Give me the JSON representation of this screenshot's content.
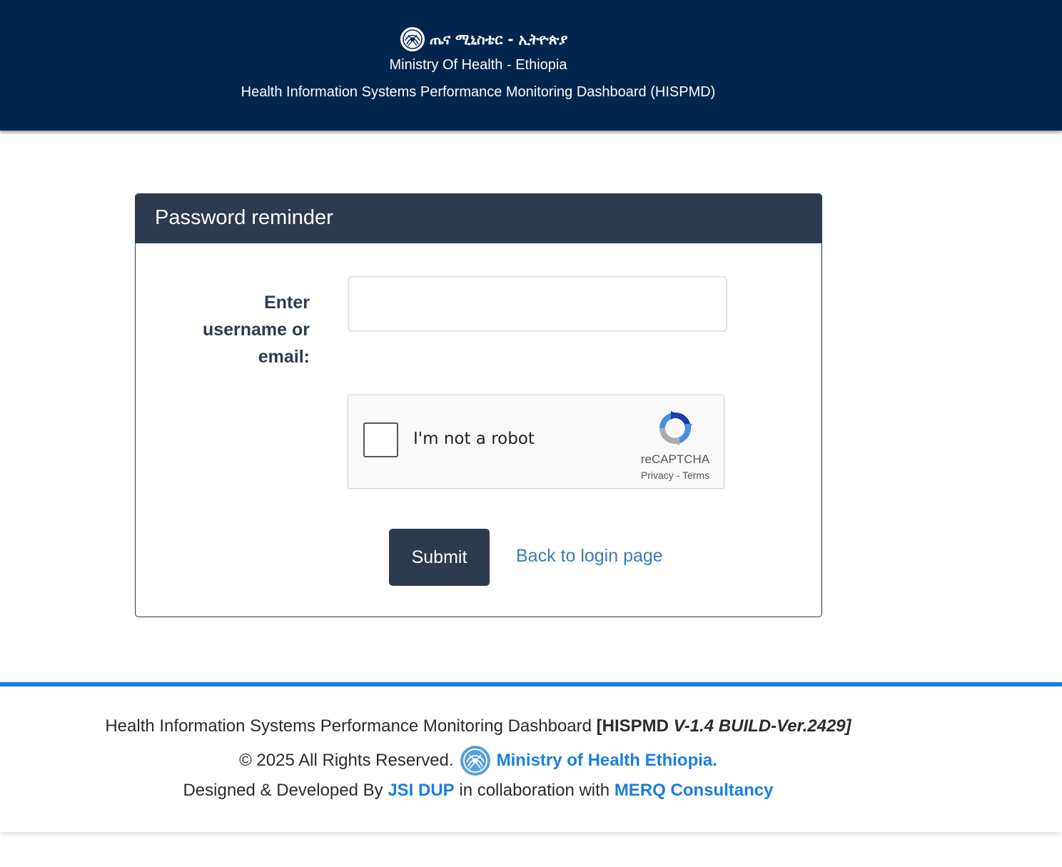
{
  "header": {
    "amharic_title": "ጤና ሚኒስቴር - ኢትዮጵያ",
    "ministry": "Ministry Of Health - Ethiopia",
    "system": "Health Information Systems Performance Monitoring Dashboard (HISPMD)",
    "logo_icon": "moh-emblem-icon"
  },
  "card": {
    "title": "Password reminder",
    "label_lines": [
      "Enter",
      "username or",
      "email:"
    ],
    "input_value": "",
    "input_placeholder": ""
  },
  "recaptcha": {
    "label": "I'm not a robot",
    "brand": "reCAPTCHA",
    "privacy": "Privacy",
    "separator": " - ",
    "terms": "Terms",
    "checked": false
  },
  "actions": {
    "submit_label": "Submit",
    "back_link": "Back to login page"
  },
  "footer": {
    "system_name": "Health Information Systems Performance Monitoring Dashboard ",
    "version_prefix": "[HISPMD ",
    "version_italic": "V-1.4 BUILD-Ver.2429]",
    "copyright": "© 2025 All Rights Reserved.",
    "ministry_link": "Ministry of Health Ethiopia.",
    "designed_by": "Designed & Developed By ",
    "jsi_link": "JSI DUP",
    "collab_text": " in collaboration with ",
    "merq_link": "MERQ Consultancy"
  },
  "colors": {
    "header_bg": "#00264d",
    "card_header_bg": "#2d3b4e",
    "accent_blue": "#1a7fe0",
    "back_link": "#3d7ab8"
  }
}
